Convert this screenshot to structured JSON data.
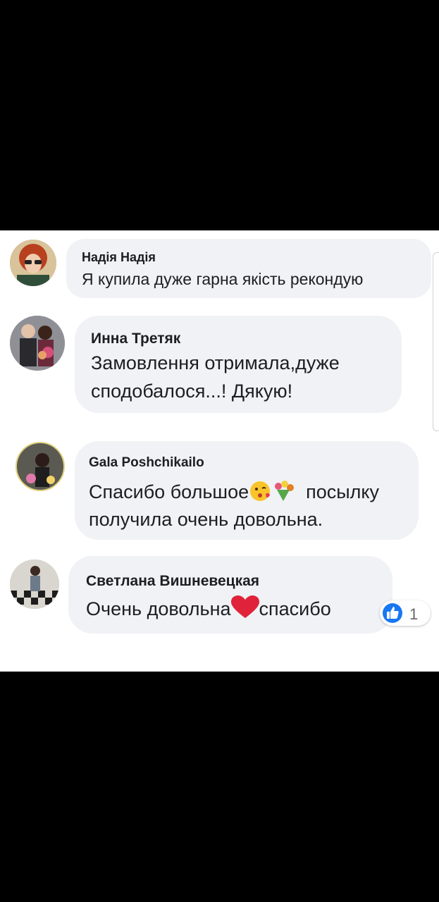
{
  "comments": [
    {
      "author": "Надія Надія",
      "lines": [
        "Я купила дуже гарна якість рекондую"
      ],
      "avatar_icon": "avatar-woman-glasses"
    },
    {
      "author": "Инна Третяк",
      "lines": [
        "Замовлення отримала,дуже",
        "сподобалося...! Дякую!"
      ],
      "avatar_icon": "avatar-couple-flowers"
    },
    {
      "author": "Gala Poshchikailo",
      "line1_before": "Спасибо большое",
      "line1_after": "посылку",
      "line2": "получила очень довольна.",
      "emojis": [
        "kiss-face-emoji",
        "bouquet-emoji"
      ],
      "avatar_icon": "avatar-woman-flowers"
    },
    {
      "author": "Светлана Вишневецкая",
      "line_before": "Очень довольна",
      "line_after": "спасибо",
      "emojis": [
        "red-heart-emoji"
      ],
      "avatar_icon": "avatar-checkered-floor",
      "reaction": {
        "icon": "like-icon",
        "count": "1"
      }
    }
  ],
  "colors": {
    "bubble": "#f0f2f5",
    "text": "#1c1e21",
    "like": "#1877f2",
    "frame": "#000000"
  }
}
